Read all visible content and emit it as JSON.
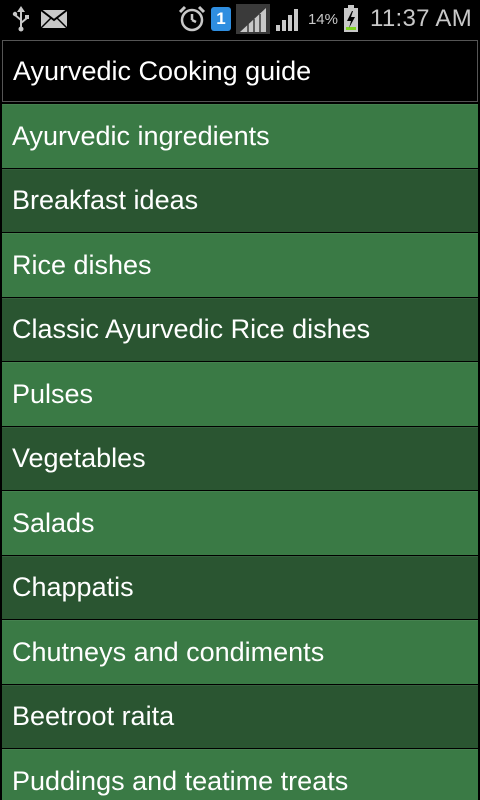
{
  "status_bar": {
    "left_icons": [
      "usb-icon",
      "email-icon"
    ],
    "right_icons": [
      "alarm-icon",
      "sim-badge",
      "signal-icon",
      "signal-icon",
      "battery-charging-icon"
    ],
    "sim_number": "1",
    "battery_percent": "14%",
    "time": "11:37 AM"
  },
  "app": {
    "title": "Ayurvedic Cooking guide",
    "colors": {
      "row_light": "#3a7a45",
      "row_dark": "#2a5531",
      "title_bg": "#000000"
    },
    "menu_items": [
      {
        "label": "Ayurvedic ingredients"
      },
      {
        "label": "Breakfast ideas"
      },
      {
        "label": "Rice dishes"
      },
      {
        "label": "Classic Ayurvedic Rice dishes"
      },
      {
        "label": "Pulses"
      },
      {
        "label": "Vegetables"
      },
      {
        "label": "Salads"
      },
      {
        "label": "Chappatis"
      },
      {
        "label": "Chutneys and condiments"
      },
      {
        "label": "Beetroot raita"
      },
      {
        "label": "Puddings and teatime treats"
      }
    ]
  }
}
